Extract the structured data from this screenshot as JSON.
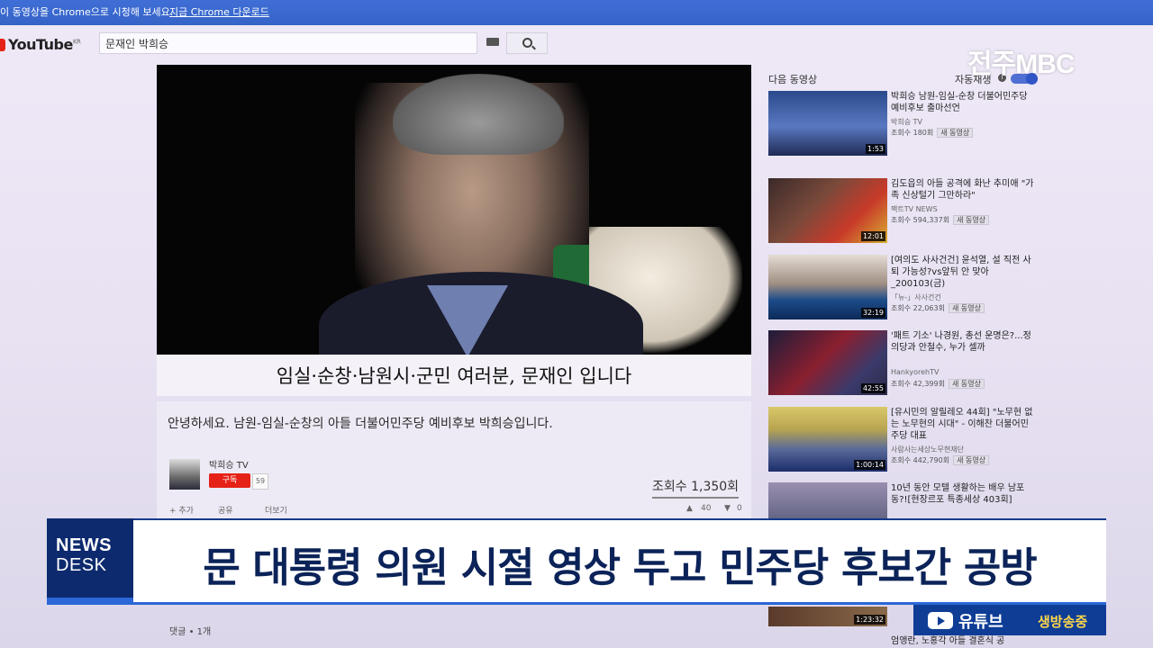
{
  "browser": {
    "banner_text": "이 동영상을 Chrome으로 시청해 보세요.",
    "banner_link": "지금 Chrome 다운로드"
  },
  "youtube": {
    "logo_text": "YouTube",
    "logo_region": "KR",
    "search_value": "문재인 박희승"
  },
  "video": {
    "subtitle": "임실·순창·남원시·군민 여러분, 문재인 입니다",
    "title": "안녕하세요. 남원-임실-순창의 아들 더불어민주당 예비후보 박희승입니다.",
    "channel": "박희승 TV",
    "subscribe_label": "구독",
    "subscriber_count": "59",
    "views": "조회수 1,350회",
    "actions": {
      "add": "+ 추가",
      "share": "공유",
      "more": "더보기"
    },
    "likes": "40",
    "dislikes": "0",
    "comments_label": "댓글 • 1개"
  },
  "sidebar": {
    "up_next_label": "다음 동영상",
    "autoplay_label": "자동재생",
    "info_icon": "i",
    "items": [
      {
        "title": "박희승 남원-임실-순창 더불어민주당 예비후보 출마선언",
        "channel": "박희승 TV",
        "views": "조회수 180회",
        "badge": "새 동영상",
        "duration": "1:53"
      },
      {
        "title": "김도읍의 아들 공격에 화난 추미애 \"가족 신상털기 그만하라\"",
        "channel": "팩트TV NEWS",
        "views": "조회수 594,337회",
        "badge": "새 동영상",
        "duration": "12:01"
      },
      {
        "title": "[여의도 사사건건] 윤석열, 설 직전 사퇴 가능성?vs앞뒤 안 맞아_200103(금)",
        "channel": "「뉴-」사사건건",
        "views": "조회수 22,063회",
        "badge": "새 동영상",
        "duration": "32:19"
      },
      {
        "title": "'패트 기소' 나경원, 총선 운명은?...정의당과 안철수, 누가 셀까",
        "channel": "HankyorehTV",
        "views": "조회수 42,399회",
        "badge": "새 동영상",
        "duration": "42:55"
      },
      {
        "title": "[유시민의 알릴레오 44회] \"노무현 없는 노무현의 시대\" - 이해찬 더불어민주당 대표",
        "channel": "사람사는세상노무현재단",
        "views": "조회수 442,790회",
        "badge": "새 동영상",
        "duration": "1:00:14"
      },
      {
        "title": "10년 동안 모텔 생활하는 배우 남포동?![현장르포 특종세상 403회]",
        "channel": "",
        "views": "",
        "badge": "",
        "duration": ""
      }
    ],
    "bottom_title": "엄앵란, 노홍각 아들 결혼식 공",
    "bottom_duration": "1:23:32"
  },
  "broadcast": {
    "station": "전주MBC",
    "program_line1": "NEWS",
    "program_line2": "DESK",
    "headline": "문 대통령 의원 시절 영상 두고 민주당 후보간 공방",
    "youtube_live_a": "유튜브",
    "youtube_live_b": "생방송중"
  },
  "colors": {
    "banner_blue": "#3563c7",
    "news_navy": "#0d2a6e",
    "headline_text": "#0b2358",
    "youtube_red": "#e62117"
  }
}
